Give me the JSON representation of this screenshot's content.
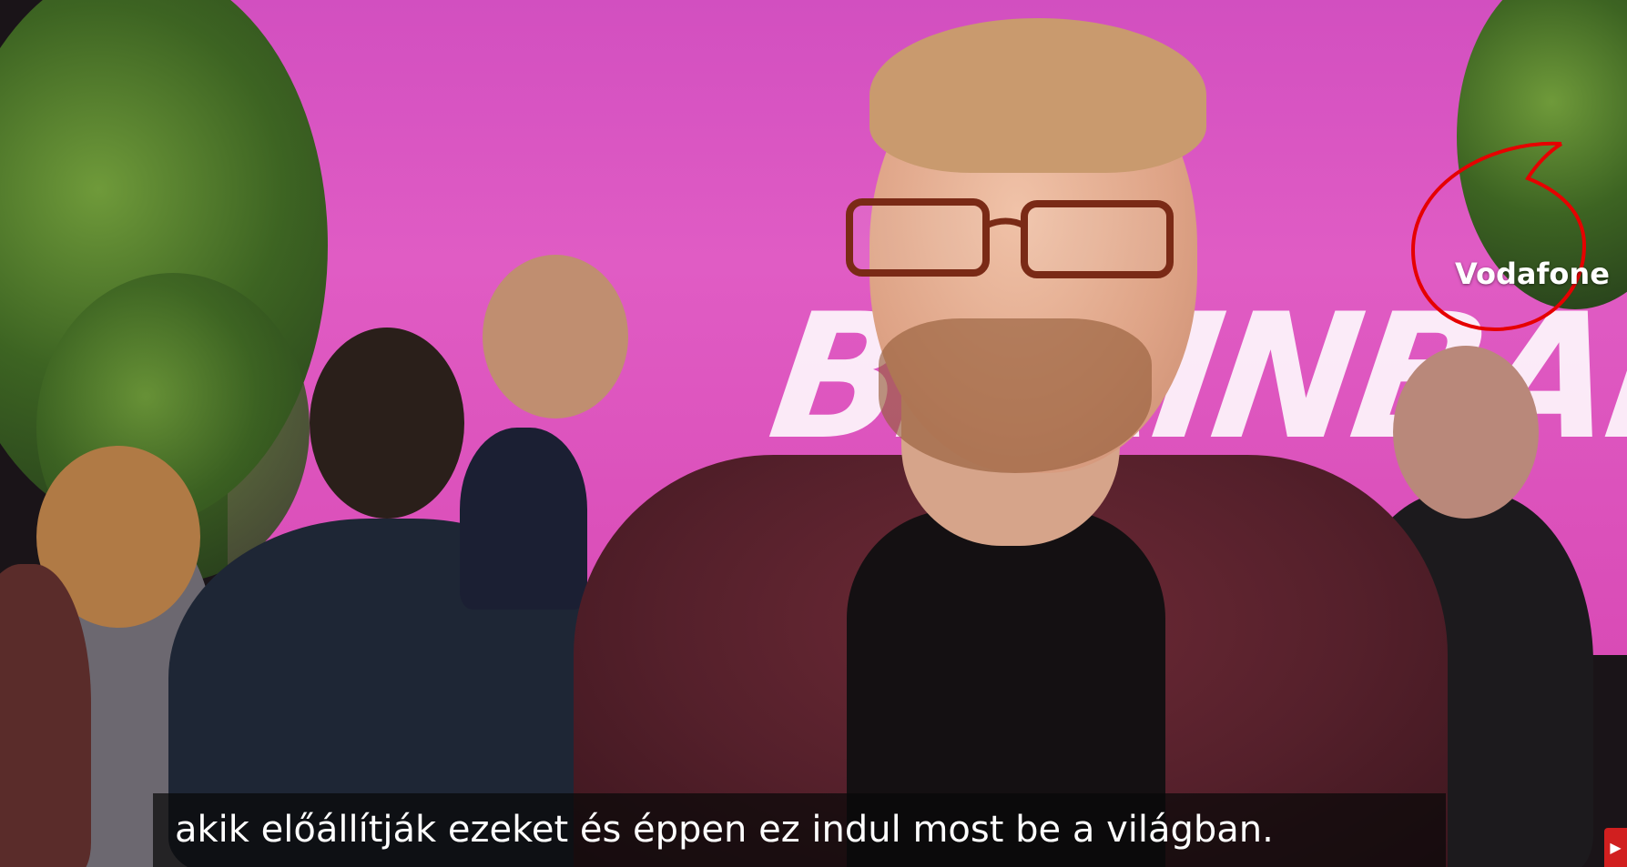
{
  "video": {
    "subtitle": "akik előállítják ezeket és éppen ez indul most be a világban.",
    "backdrop_text": "BRAINBAR"
  },
  "watermark": {
    "brand": "Vodafone",
    "color": "#e60000",
    "icon": "vodafone-speechmark-icon"
  },
  "controls": {
    "corner_icon": "play-icon",
    "corner_color": "#d11f1f"
  }
}
